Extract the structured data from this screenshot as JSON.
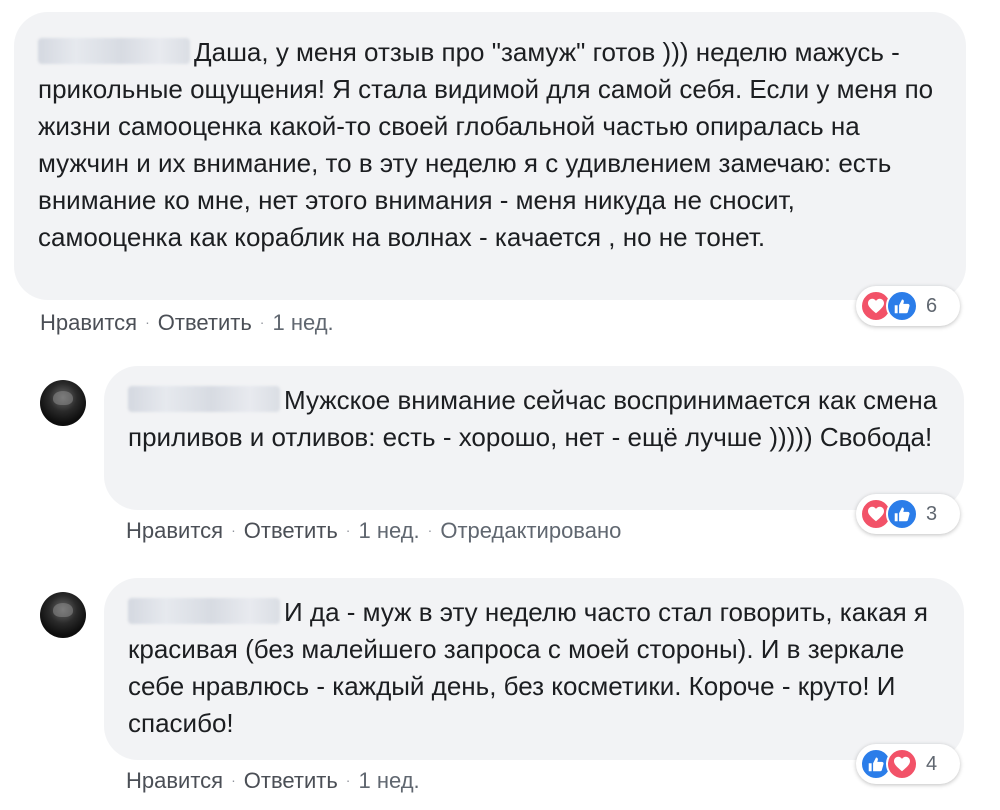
{
  "comments": [
    {
      "text": "Даша, у меня отзыв про \"замуж\" готов ))) неделю мажусь - прикольные ощущения! Я стала видимой для самой себя. Если у меня по жизни самооценка какой-то своей глобальной частью опиралась на мужчин и их внимание, то в эту неделю я с удивлением замечаю: есть внимание ко мне, нет этого внимания - меня никуда не сносит, самооценка как кораблик на волнах - качается , но не тонет.",
      "like_label": "Нравится",
      "reply_label": "Ответить",
      "time": "1 нед.",
      "reaction_count": "6"
    },
    {
      "text": "Мужское внимание сейчас воспринимается как смена приливов и отливов: есть - хорошо, нет - ещё лучше ))))) Свобода!",
      "like_label": "Нравится",
      "reply_label": "Ответить",
      "time": "1 нед.",
      "edited": "Отредактировано",
      "reaction_count": "3"
    },
    {
      "text": "И да - муж в эту неделю часто стал говорить, какая я красивая (без малейшего запроса с моей стороны). И в зеркале себе нравлюсь - каждый день, без косметики. Короче - круто! И спасибо!",
      "like_label": "Нравится",
      "reply_label": "Ответить",
      "time": "1 нед.",
      "reaction_count": "4"
    }
  ],
  "icons": {
    "love": "heart-icon",
    "like": "thumbs-up-icon",
    "avatar": "user-avatar"
  },
  "colors": {
    "bubble": "#f2f3f5",
    "love": "#f25268",
    "like": "#2b7de9",
    "meta": "#606770"
  }
}
